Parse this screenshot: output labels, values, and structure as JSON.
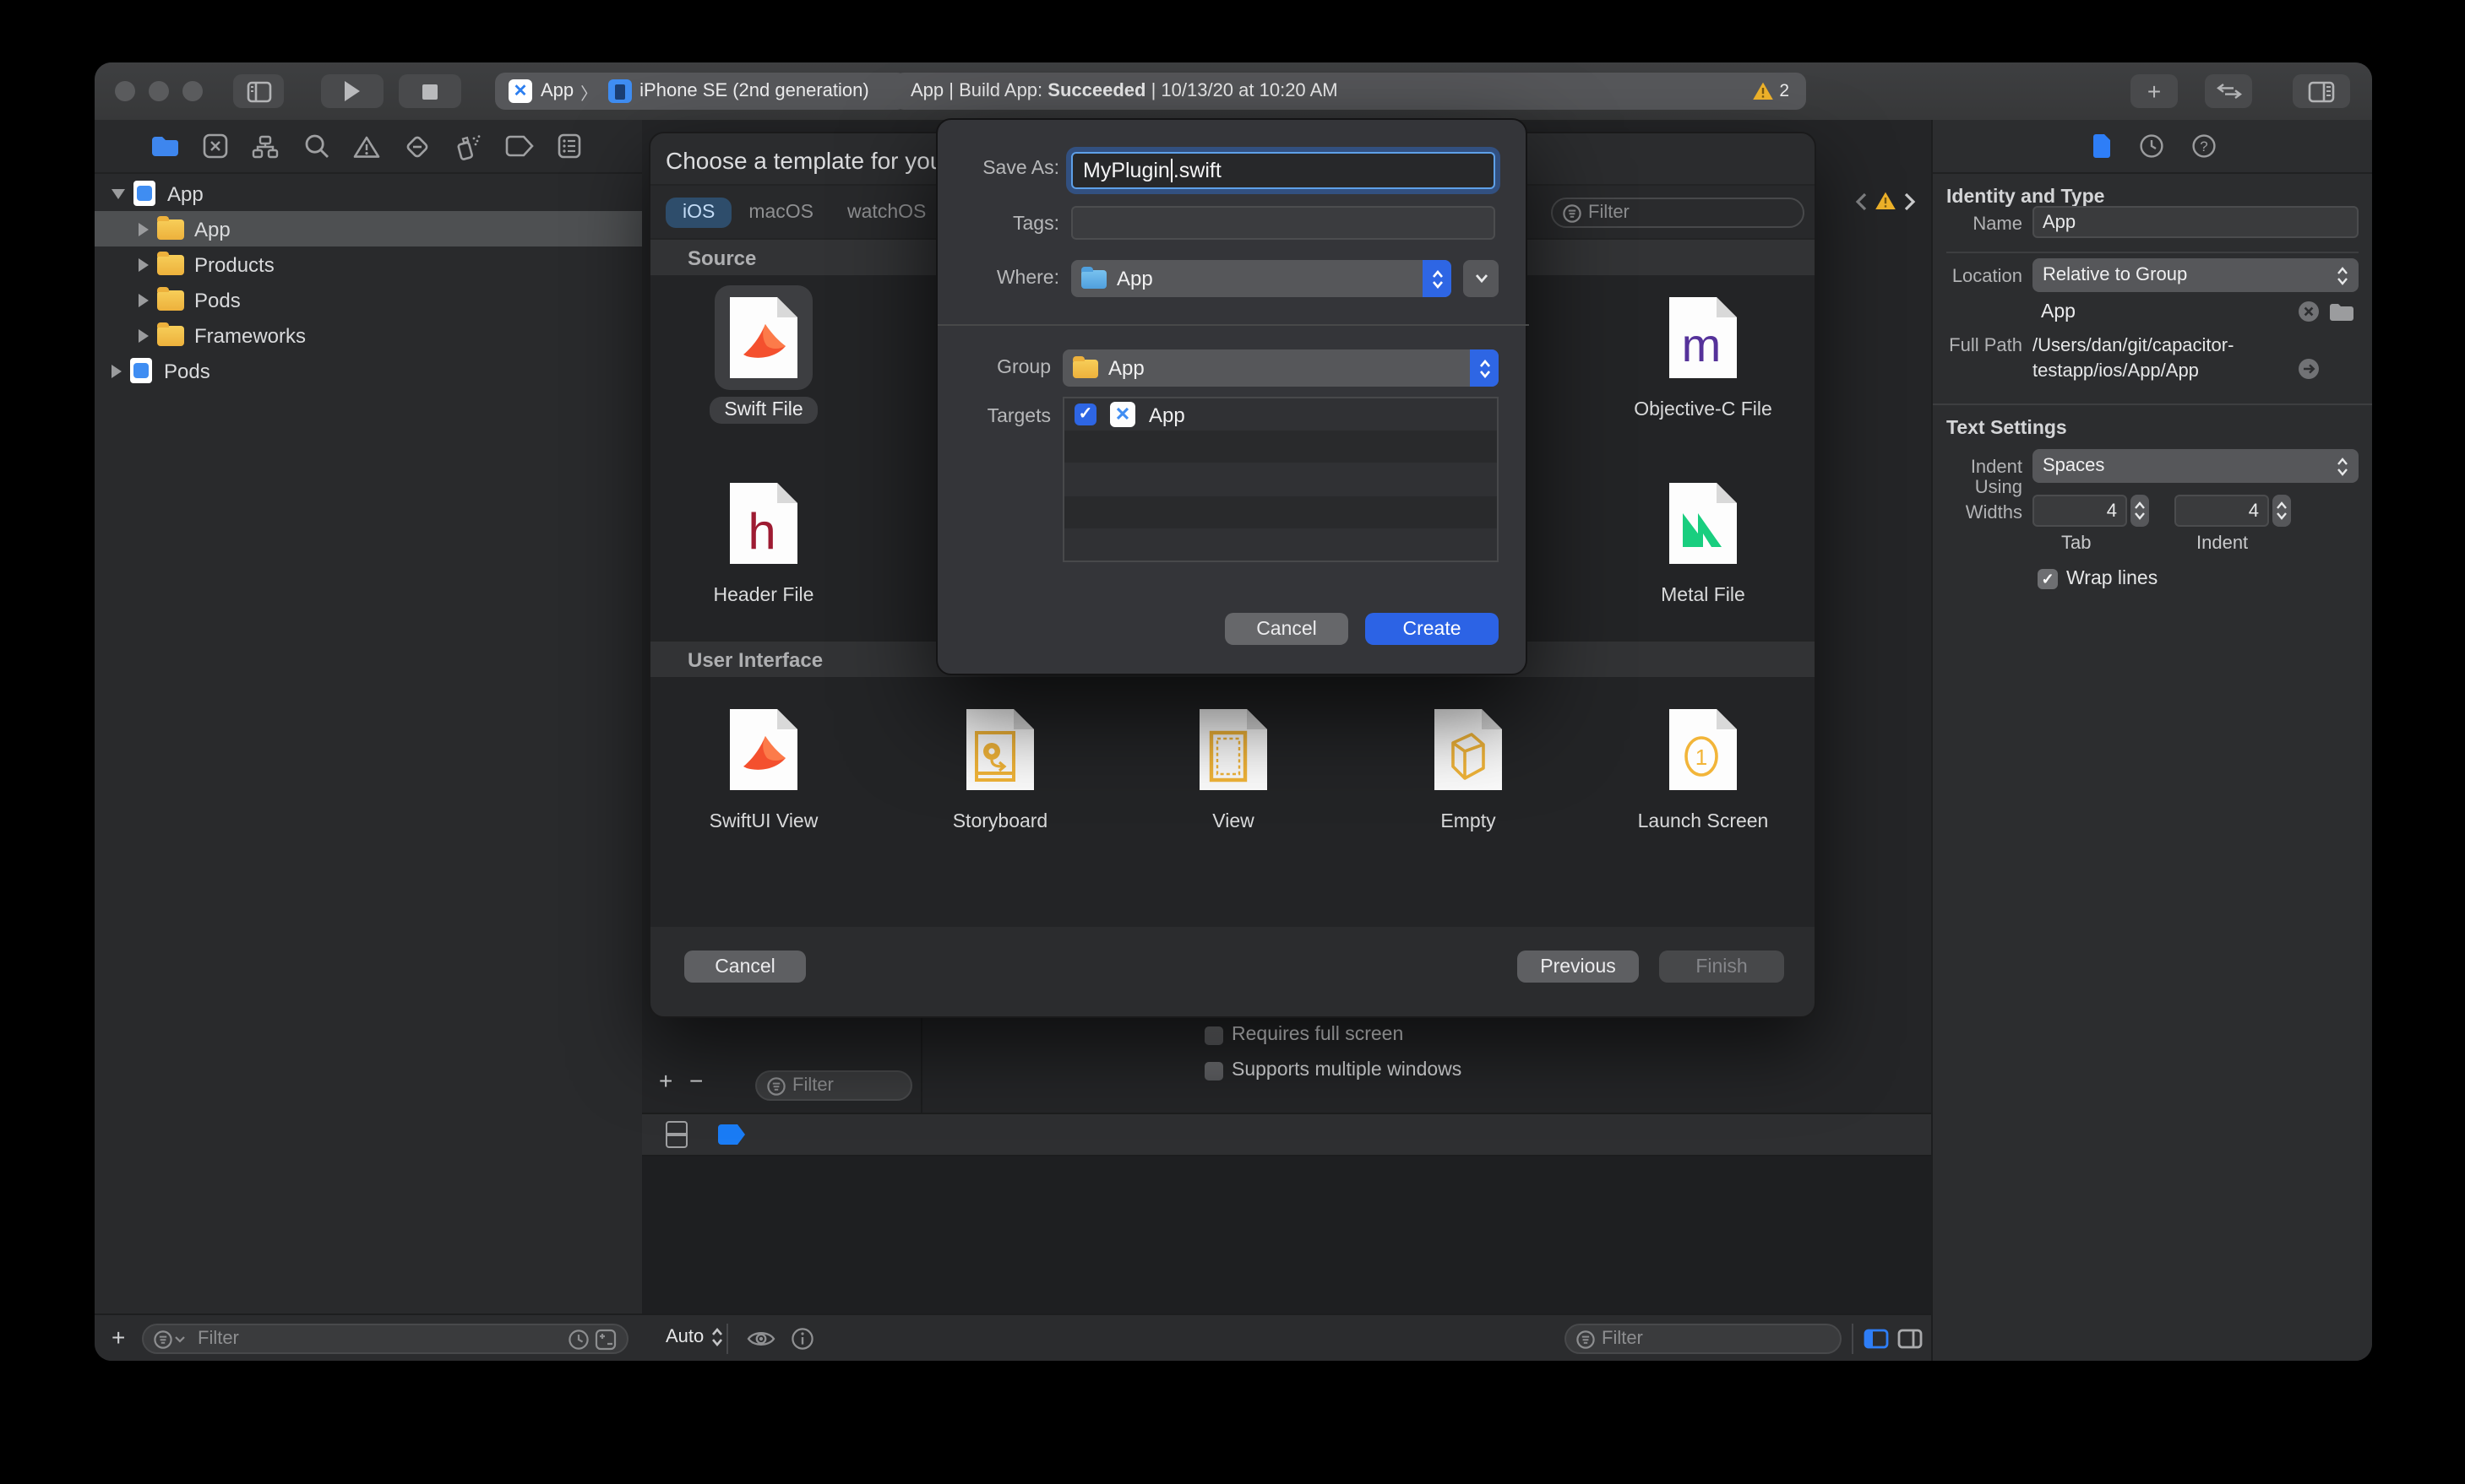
{
  "toolbar": {
    "scheme_project": "App",
    "scheme_device": "iPhone SE (2nd generation)",
    "status_prefix": "App | Build App: ",
    "status_bold": "Succeeded",
    "status_suffix": " | 10/13/20 at 10:20 AM",
    "warning_count": "2"
  },
  "navigator": {
    "items": {
      "project": "App",
      "app_group": "App",
      "products": "Products",
      "pods_group": "Pods",
      "frameworks": "Frameworks",
      "pods_project": "Pods"
    },
    "filter_placeholder": "Filter"
  },
  "sheet": {
    "title": "Choose a template for your",
    "tabs": {
      "ios": "iOS",
      "macos": "macOS",
      "watchos": "watchOS"
    },
    "filter_placeholder": "Filter",
    "source_header": "Source",
    "ui_header": "User Interface",
    "templates": {
      "swift": "Swift File",
      "header": "Header File",
      "objc": "Objective-C File",
      "metal": "Metal File",
      "swiftui": "SwiftUI View",
      "storyboard": "Storyboard",
      "view": "View",
      "empty": "Empty",
      "launch": "Launch Screen"
    },
    "cancel": "Cancel",
    "previous": "Previous",
    "finish": "Finish"
  },
  "dialog": {
    "save_as_label": "Save As:",
    "save_as_name": "MyPlugin",
    "save_as_ext": ".swift",
    "tags_label": "Tags:",
    "where_label": "Where:",
    "where_value": "App",
    "group_label": "Group",
    "group_value": "App",
    "targets_label": "Targets",
    "target_name": "App",
    "cancel": "Cancel",
    "create": "Create"
  },
  "editor": {
    "requires_full_screen": "Requires full screen",
    "supports_multiple_windows": "Supports multiple windows",
    "auto_label": "Auto",
    "filter_placeholder": "Filter"
  },
  "inspector": {
    "identity_header": "Identity and Type",
    "name_label": "Name",
    "name_value": "App",
    "location_label": "Location",
    "location_value": "Relative to Group",
    "group_value": "App",
    "full_path_label": "Full Path",
    "full_path_line1": "/Users/dan/git/capacitor-",
    "full_path_line2": "testapp/ios/App/App",
    "text_settings_header": "Text Settings",
    "indent_using_label": "Indent Using",
    "indent_using_value": "Spaces",
    "widths_label": "Widths",
    "tab_width": "4",
    "indent_width": "4",
    "tab_caption": "Tab",
    "indent_caption": "Indent",
    "wrap_label": "Wrap lines"
  }
}
